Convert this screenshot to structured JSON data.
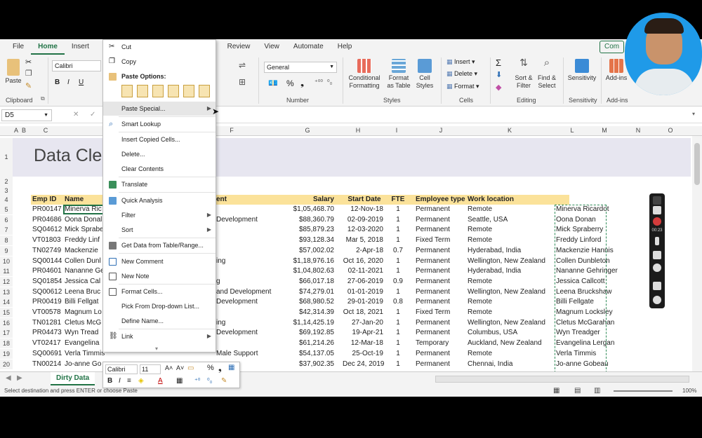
{
  "menu": [
    "File",
    "Home",
    "Insert",
    "P",
    "Review",
    "View",
    "Automate",
    "Help"
  ],
  "comment_btn": "Com",
  "ribbon": {
    "clipboard": "Clipboard",
    "paste": "Paste",
    "font_name": "Calibri",
    "bold": "B",
    "italic": "I",
    "underline": "U",
    "number_format": "General",
    "percent": "%",
    "number": "Number",
    "conditional": "Conditional Formatting",
    "format_table": "Format as Table",
    "cell_styles": "Cell Styles",
    "styles": "Styles",
    "insert": "Insert",
    "delete": "Delete",
    "format": "Format",
    "cells": "Cells",
    "sort_filter": "Sort & Filter",
    "find_select": "Find & Select",
    "editing": "Editing",
    "sensitivity": "Sensitivity",
    "addins": "Add-ins",
    "nt": "nt"
  },
  "formula": {
    "namebox": "D5"
  },
  "columns": [
    "A",
    "B",
    "C",
    "F",
    "G",
    "H",
    "I",
    "J",
    "K",
    "L",
    "M",
    "N",
    "O"
  ],
  "sheet_title": "Data Cle",
  "headers": {
    "emp_id": "Emp ID",
    "name": "Name",
    "dept": "ent",
    "salary": "Salary",
    "start": "Start Date",
    "fte": "FTE",
    "type": "Employee type",
    "loc": "Work location"
  },
  "rows": [
    {
      "r": "5",
      "id": "PR00147",
      "name": "Minerva Ric",
      "dept": "",
      "salary": "$1,05,468.70",
      "start": "12-Nov-18",
      "fte": "1",
      "type": "Permanent",
      "loc": "Remote",
      "copy": "Minerva Ricardot"
    },
    {
      "r": "6",
      "id": "PR04686",
      "name": "Oona Donal",
      "dept": "Development",
      "salary": "$88,360.79",
      "start": "02-09-2019",
      "fte": "1",
      "type": "Permanent",
      "loc": "Seattle, USA",
      "copy": "Oona Donan"
    },
    {
      "r": "7",
      "id": "SQ04612",
      "name": "Mick Sprabe",
      "dept": "",
      "salary": "$85,879.23",
      "start": "12-03-2020",
      "fte": "1",
      "type": "Permanent",
      "loc": "Remote",
      "copy": "Mick Spraberry"
    },
    {
      "r": "8",
      "id": "VT01803",
      "name": "Freddy Linf",
      "dept": "",
      "salary": "$93,128.34",
      "start": "Mar 5, 2018",
      "fte": "1",
      "type": "Fixed Term",
      "loc": "Remote",
      "copy": "Freddy Linford"
    },
    {
      "r": "9",
      "id": "TN02749",
      "name": "Mackenzie",
      "dept": "",
      "salary": "$57,002.02",
      "start": "2-Apr-18",
      "fte": "0.7",
      "type": "Permanent",
      "loc": "Hyderabad, India",
      "copy": "Mackenzie Hannis"
    },
    {
      "r": "10",
      "id": "SQ00144",
      "name": "Collen Dunl",
      "dept": "ing",
      "salary": "$1,18,976.16",
      "start": "Oct 16, 2020",
      "fte": "1",
      "type": "Permanent",
      "loc": "Wellington, New Zealand",
      "copy": "Collen Dunbleton"
    },
    {
      "r": "11",
      "id": "PR04601",
      "name": "Nananne Ge",
      "dept": "",
      "salary": "$1,04,802.63",
      "start": "02-11-2021",
      "fte": "1",
      "type": "Permanent",
      "loc": "Hyderabad, India",
      "copy": "Nananne Gehringer"
    },
    {
      "r": "12",
      "id": "SQ01854",
      "name": "Jessica Cal",
      "dept": "g",
      "salary": "$66,017.18",
      "start": "27-06-2019",
      "fte": "0.9",
      "type": "Permanent",
      "loc": "Remote",
      "copy": "Jessica Callcott"
    },
    {
      "r": "13",
      "id": "SQ00612",
      "name": "Leena Bruc",
      "dept": "and Development",
      "salary": "$74,279.01",
      "start": "01-01-2019",
      "fte": "1",
      "type": "Permanent",
      "loc": "Wellington, New Zealand",
      "copy": "Leena Bruckshaw"
    },
    {
      "r": "14",
      "id": "PR00419",
      "name": "Billi Fellgat",
      "dept": "Development",
      "salary": "$68,980.52",
      "start": "29-01-2019",
      "fte": "0.8",
      "type": "Permanent",
      "loc": "Remote",
      "copy": "Billi Fellgate"
    },
    {
      "r": "15",
      "id": "VT00578",
      "name": "Magnum Lo",
      "dept": "",
      "salary": "$42,314.39",
      "start": "Oct 18, 2021",
      "fte": "1",
      "type": "Fixed Term",
      "loc": "Remote",
      "copy": "Magnum Locksley"
    },
    {
      "r": "16",
      "id": "TN01281",
      "name": "Cletus McG",
      "dept": "ing",
      "salary": "$1,14,425.19",
      "start": "27-Jan-20",
      "fte": "1",
      "type": "Permanent",
      "loc": "Wellington, New Zealand",
      "copy": "Cletus McGarahan"
    },
    {
      "r": "17",
      "id": "PR04473",
      "name": "Wyn Tread",
      "dept": "Development",
      "salary": "$69,192.85",
      "start": "19-Apr-21",
      "fte": "1",
      "type": "Permanent",
      "loc": "Columbus, USA",
      "copy": "Wyn Treadger"
    },
    {
      "r": "18",
      "id": "VT02417",
      "name": "Evangelina",
      "dept": "",
      "salary": "$61,214.26",
      "start": "12-Mar-18",
      "fte": "1",
      "type": "Temporary",
      "loc": "Auckland, New Zealand",
      "copy": "Evangelina Lergan"
    },
    {
      "r": "19",
      "id": "SQ00691",
      "name": "Verla Timmis",
      "dept": "Male    Support",
      "salary": "$54,137.05",
      "start": "25-Oct-19",
      "fte": "1",
      "type": "Permanent",
      "loc": "Remote",
      "copy": "Verla Timmis"
    },
    {
      "r": "20",
      "id": "TN00214",
      "name": "Jo-anne Go",
      "dept": "",
      "salary": "$37,902.35",
      "start": "Dec 24, 2019",
      "fte": "1",
      "type": "Permanent",
      "loc": "Chennai, India",
      "copy": "Jo-anne Gobeau"
    }
  ],
  "context_menu": {
    "cut": "Cut",
    "copy": "Copy",
    "paste_options": "Paste Options:",
    "paste_special": "Paste Special...",
    "smart_lookup": "Smart Lookup",
    "insert_copied": "Insert Copied Cells...",
    "delete": "Delete...",
    "clear": "Clear Contents",
    "translate": "Translate",
    "quick_analysis": "Quick Analysis",
    "filter": "Filter",
    "sort": "Sort",
    "get_data": "Get Data from Table/Range...",
    "new_comment": "New Comment",
    "new_note": "New Note",
    "format_cells": "Format Cells...",
    "pick_list": "Pick From Drop-down List...",
    "define_name": "Define Name...",
    "link": "Link"
  },
  "mini_toolbar": {
    "font": "Calibri",
    "size": "11",
    "percent": "%"
  },
  "sheet_tab": "Dirty Data",
  "status_text": "Select destination and press ENTER or choose Paste",
  "zoom": "100%",
  "rec_time": "00:23"
}
